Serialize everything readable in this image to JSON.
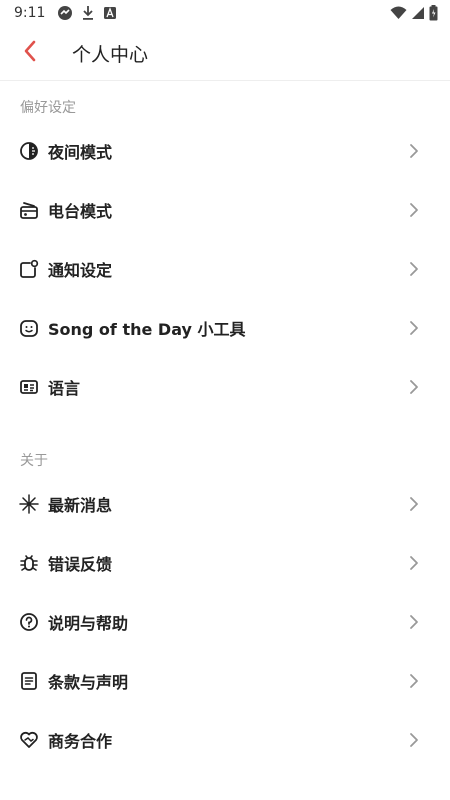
{
  "status_bar": {
    "time": "9:11",
    "left_icons": [
      "sync-icon",
      "download-icon",
      "font-a-icon"
    ],
    "right_icons": [
      "wifi-icon",
      "signal-icon",
      "battery-icon"
    ]
  },
  "header": {
    "title": "个人中心",
    "back_icon": "chevron-left-icon",
    "accent_color": "#e0524c"
  },
  "sections": [
    {
      "label": "偏好设定",
      "items": [
        {
          "label": "夜间模式",
          "icon": "dark-mode-icon"
        },
        {
          "label": "电台模式",
          "icon": "radio-icon"
        },
        {
          "label": "通知设定",
          "icon": "notification-icon"
        },
        {
          "label": "Song of the Day 小工具",
          "icon": "widget-icon"
        },
        {
          "label": "语言",
          "icon": "language-icon"
        }
      ]
    },
    {
      "label": "关于",
      "items": [
        {
          "label": "最新消息",
          "icon": "sparkle-icon"
        },
        {
          "label": "错误反馈",
          "icon": "bug-icon"
        },
        {
          "label": "说明与帮助",
          "icon": "help-icon"
        },
        {
          "label": "条款与声明",
          "icon": "document-icon"
        },
        {
          "label": "商务合作",
          "icon": "handshake-icon"
        }
      ]
    }
  ],
  "colors": {
    "text_primary": "#222222",
    "section_label": "#999999",
    "chevron": "#999999",
    "divider": "#eeeeee"
  }
}
